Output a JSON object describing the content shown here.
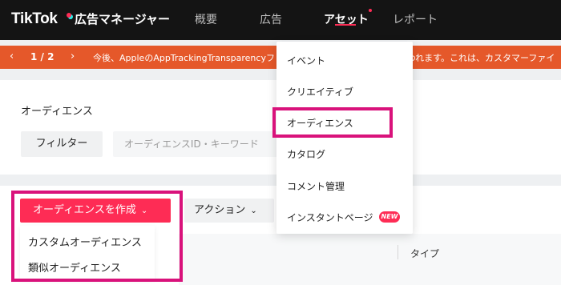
{
  "header": {
    "logo": "TikTok",
    "product": "広告マネージャー",
    "nav": [
      "概要",
      "広告",
      "アセット",
      "レポート"
    ],
    "active_index": 2
  },
  "banner": {
    "prev": "‹",
    "pager": "1 / 2",
    "next": "›",
    "message": "今後、AppleのAppTrackingTransparencyフレームワークに準拠した変更が行われます。これは、カスタマーファイ"
  },
  "filters": {
    "section_title": "オーディエンス",
    "filter_label": "フィルター",
    "search_placeholder": "オーディエンスID・キーワード"
  },
  "toolbar": {
    "create_label": "オーディエンスを作成",
    "action_label": "アクション"
  },
  "create_menu": {
    "items": [
      "カスタムオーディエンス",
      "類似オーディエンス"
    ]
  },
  "assets_menu": {
    "items": [
      "イベント",
      "クリエイティブ",
      "オーディエンス",
      "カタログ",
      "コメント管理",
      "インスタントページ"
    ],
    "new_badge": "NEW"
  },
  "table": {
    "type_header": "タイプ"
  },
  "colors": {
    "brand": "#fe2c55",
    "banner": "#e5582a",
    "highlight": "#d9127b"
  }
}
